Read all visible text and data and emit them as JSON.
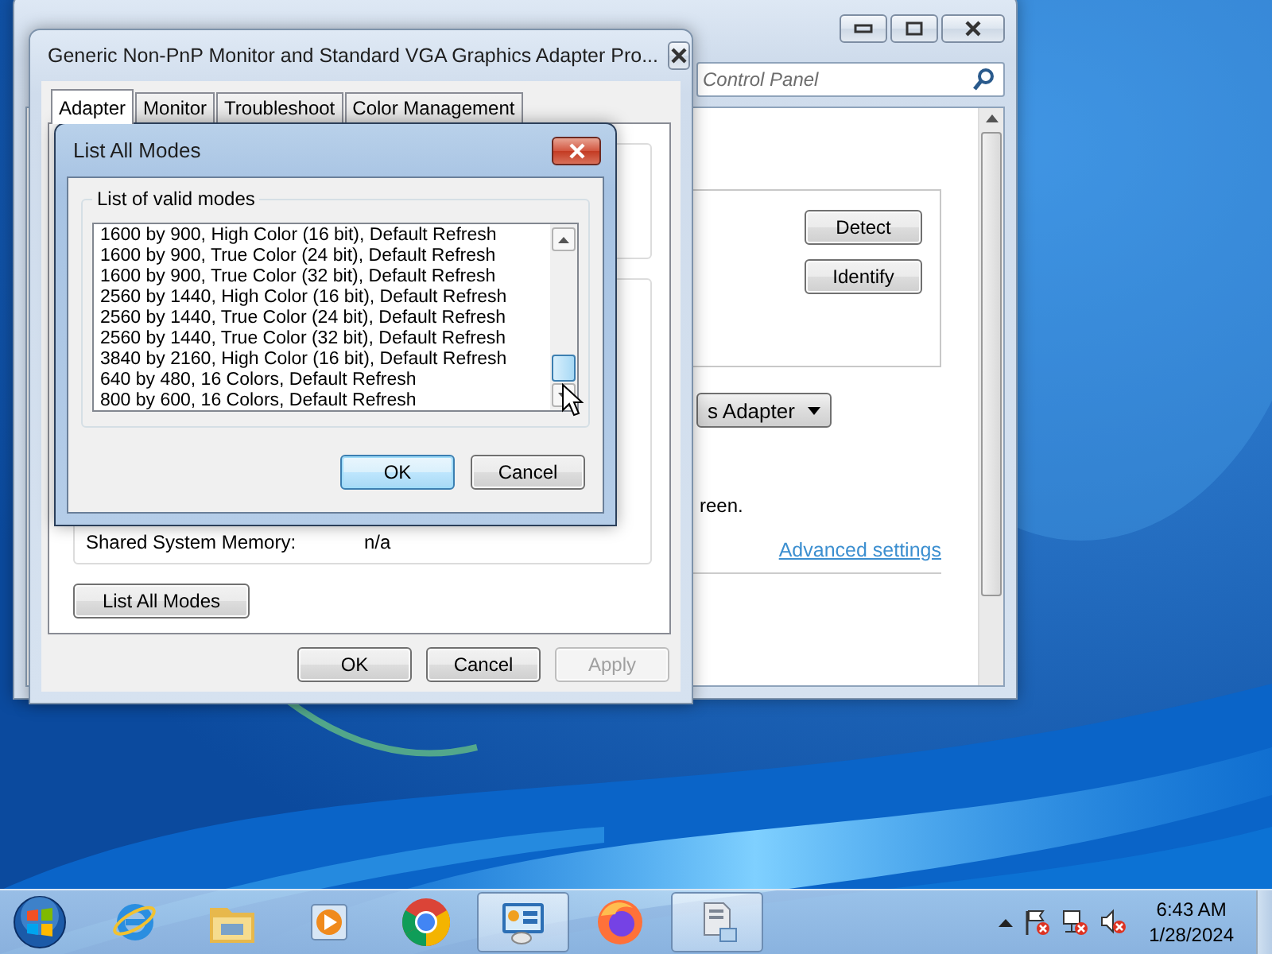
{
  "control_panel": {
    "search": {
      "placeholder": "Control Panel"
    },
    "buttons": [
      "Detect",
      "Identify"
    ],
    "dropdown": {
      "value": "s Adapter"
    },
    "text": "reen.",
    "link": "Advanced settings"
  },
  "properties_dialog": {
    "title": "Generic Non-PnP Monitor and Standard VGA Graphics Adapter Pro...",
    "tabs": [
      {
        "label": "Adapter",
        "selected": true
      },
      {
        "label": "Monitor",
        "selected": false
      },
      {
        "label": "Troubleshoot",
        "selected": false
      },
      {
        "label": "Color Management",
        "selected": false
      }
    ],
    "info": {
      "label": "Shared System Memory:",
      "value": "n/a"
    },
    "list_button": "List All Modes",
    "buttons": [
      {
        "label": "OK",
        "disabled": false
      },
      {
        "label": "Cancel",
        "disabled": false
      },
      {
        "label": "Apply",
        "disabled": true
      }
    ]
  },
  "modes_dialog": {
    "title": "List All Modes",
    "group": "List of valid modes",
    "modes": [
      "1600 by 900, High Color (16 bit), Default Refresh",
      "1600 by 900, True Color (24 bit), Default Refresh",
      "1600 by 900, True Color (32 bit), Default Refresh",
      "2560 by 1440, High Color (16 bit), Default Refresh",
      "2560 by 1440, True Color (24 bit), Default Refresh",
      "2560 by 1440, True Color (32 bit), Default Refresh",
      "3840 by 2160, High Color (16 bit), Default Refresh",
      "640 by 480, 16 Colors, Default Refresh",
      "800 by 600, 16 Colors, Default Refresh"
    ],
    "buttons": [
      {
        "label": "OK",
        "default": true
      },
      {
        "label": "Cancel",
        "default": false
      }
    ]
  },
  "taskbar": {
    "apps": [
      {
        "kind": "ie",
        "active": false
      },
      {
        "kind": "folder",
        "active": false
      },
      {
        "kind": "media",
        "active": false
      },
      {
        "kind": "chrome",
        "active": false
      },
      {
        "kind": "control",
        "active": true
      },
      {
        "kind": "firefox",
        "active": false
      },
      {
        "kind": "computer",
        "active": true
      }
    ],
    "clock": {
      "time": "6:43 AM",
      "date": "1/28/2024"
    }
  }
}
